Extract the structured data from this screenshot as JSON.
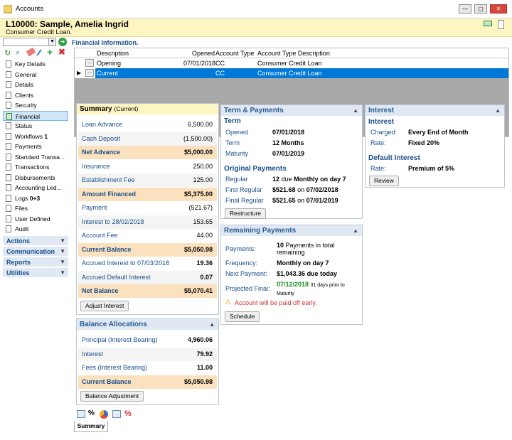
{
  "window": {
    "title": "Accounts",
    "min": "—",
    "max": "▢",
    "close": "✕"
  },
  "header": {
    "name": "L10000: Sample, Amelia Ingrid",
    "product": "Consumer Credit Loan."
  },
  "sidebar": {
    "items": [
      "Key Details",
      "General",
      "Details",
      "Clients",
      "Security",
      "Financial",
      "Status",
      "Workflows",
      "Payments",
      "Standard Transa...",
      "Transactions",
      "Disbursements",
      "Accounting Led...",
      "Logs",
      "Files",
      "User Defined",
      "Audit"
    ],
    "workflows_count": "1",
    "logs_count": "0+3",
    "sections": [
      "Actions",
      "Communication",
      "Reports",
      "Utilities"
    ]
  },
  "fin": {
    "heading": "Financial Information.",
    "columns": [
      "Description",
      "Opened",
      "Account Type",
      "Account Type Description"
    ],
    "rows": [
      {
        "desc": "Opening",
        "opened": "07/01/2018",
        "type": "CC",
        "typedesc": "Consumer Credit Loan"
      },
      {
        "desc": "Current",
        "opened": "",
        "type": "CC",
        "typedesc": "Consumer Credit Loan"
      }
    ],
    "dots": "..."
  },
  "summary": {
    "title": "Summary",
    "sub": "(Current)",
    "rows": [
      {
        "l": "Loan Advance",
        "v": "6,500.00"
      },
      {
        "l": "Cash Deposit",
        "v": "(1,500.00)"
      },
      {
        "l": "Net Advance",
        "v": "$5,000.00"
      },
      {
        "l": "Insurance",
        "v": "250.00"
      },
      {
        "l": "Establishment Fee",
        "v": "125.00"
      },
      {
        "l": "Amount Financed",
        "v": "$5,375.00"
      },
      {
        "l": "Payment",
        "v": "(521.67)"
      },
      {
        "l": "Interest to 28/02/2018",
        "v": "153.65"
      },
      {
        "l": "Account Fee",
        "v": "44.00"
      },
      {
        "l": "Current Balance",
        "v": "$5,050.98"
      },
      {
        "l": "Accrued Interest to 07/03/2018",
        "v": "19.36"
      },
      {
        "l": "Accrued Default Interest",
        "v": "0.07"
      },
      {
        "l": "Net Balance",
        "v": "$5,070.41"
      }
    ],
    "button": "Adjust Interest"
  },
  "alloc": {
    "title": "Balance Allocations",
    "rows": [
      {
        "l": "Principal (Interest Bearing)",
        "v": "4,960.06"
      },
      {
        "l": "Interest",
        "v": "79.92"
      },
      {
        "l": "Fees (Interest Bearing)",
        "v": "11.00"
      },
      {
        "l": "Current Balance",
        "v": "$5,050.98"
      }
    ],
    "button": "Balance Adjustment"
  },
  "term": {
    "title": "Term & Payments",
    "term_h": "Term",
    "opened_l": "Opened",
    "opened_v": "07/01/2018",
    "term_l": "Term",
    "term_v": "12 Months",
    "maturity_l": "Maturity",
    "maturity_v": "07/01/2019",
    "orig_h": "Original Payments",
    "regular_l": "Regular",
    "regular_n": "12",
    "regular_due": "due",
    "regular_v": "Monthly on day 7",
    "first_l": "First Regular",
    "first_v": "$521.68",
    "first_on": "on",
    "first_d": "07/02/2018",
    "final_l": "Final Regular",
    "final_v": "$521.65",
    "final_on": "on",
    "final_d": "07/01/2019",
    "button": "Restructure"
  },
  "remaining": {
    "title": "Remaining Payments",
    "pay_l": "Payments:",
    "pay_n": "10",
    "pay_v": "Payments in total remaining",
    "freq_l": "Frequency:",
    "freq_v": "Monthly on day 7",
    "next_l": "Next Payment:",
    "next_v": "$1,043.36",
    "next_s": "due today",
    "proj_l": "Projected Final:",
    "proj_v": "07/12/2018",
    "proj_s": "31 days prior to Maturity",
    "warn": "Account will be paid off early.",
    "button": "Schedule"
  },
  "interest": {
    "title": "Interest",
    "h": "Interest",
    "charged_l": "Charged:",
    "charged_v": "Every End of Month",
    "rate_l": "Rate:",
    "rate_v": "Fixed 20%",
    "def_h": "Default Interest",
    "def_rate_l": "Rate:",
    "def_rate_v": "Premium of 5%",
    "button": "Review"
  },
  "bottom": {
    "tab": "Summary",
    "pct": "%"
  },
  "colors": {
    "accent": "#1a4f8c",
    "highlight": "#fbe1bd",
    "selected": "#0078d7",
    "warn": "#d03030",
    "green": "#1a8a1a"
  }
}
